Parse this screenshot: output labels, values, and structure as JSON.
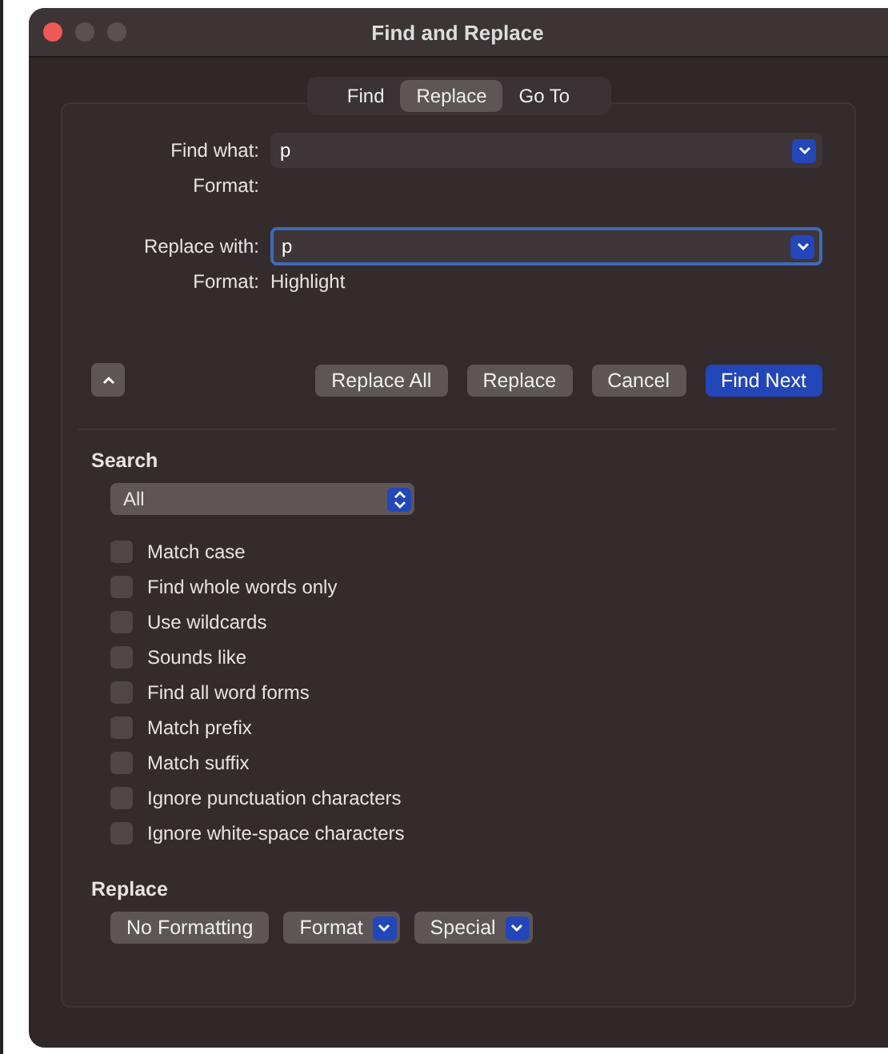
{
  "window": {
    "title": "Find and Replace"
  },
  "tabs": [
    {
      "label": "Find",
      "selected": false
    },
    {
      "label": "Replace",
      "selected": true
    },
    {
      "label": "Go To",
      "selected": false
    }
  ],
  "fields": [
    {
      "label": "Find what:",
      "value": "p",
      "focused": false,
      "format_label": "Format:"
    },
    {
      "label": "Replace with:",
      "value": "p",
      "focused": true,
      "format_label": "Format:",
      "format_value": "Highlight"
    }
  ],
  "buttons": [
    {
      "label": "Replace All",
      "default": false
    },
    {
      "label": "Replace",
      "default": false
    },
    {
      "label": "Cancel",
      "default": false
    },
    {
      "label": "Find Next",
      "default": true
    }
  ],
  "search": {
    "heading": "Search",
    "dropdown_value": "All"
  },
  "options": [
    {
      "label": "Match case",
      "checked": false
    },
    {
      "label": "Find whole words only",
      "checked": false
    },
    {
      "label": "Use wildcards",
      "checked": false
    },
    {
      "label": "Sounds like",
      "checked": false
    },
    {
      "label": "Find all word forms",
      "checked": false
    },
    {
      "label": "Match prefix",
      "checked": false
    },
    {
      "label": "Match suffix",
      "checked": false
    },
    {
      "label": "Ignore punctuation characters",
      "checked": false
    },
    {
      "label": "Ignore white-space characters",
      "checked": false
    }
  ],
  "replace": {
    "heading": "Replace",
    "buttons": [
      {
        "label": "No Formatting",
        "kind": "button"
      },
      {
        "label": "Format",
        "kind": "menu"
      },
      {
        "label": "Special",
        "kind": "menu"
      }
    ]
  }
}
